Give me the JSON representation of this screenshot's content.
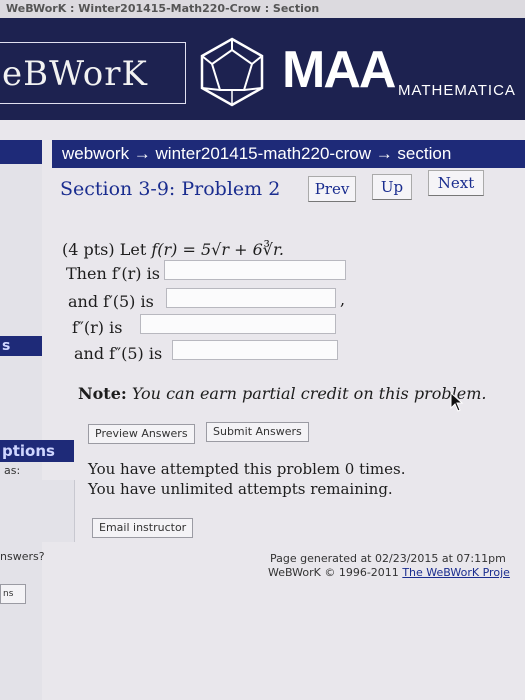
{
  "window": {
    "title": "WeBWorK : Winter201415-Math220-Crow : Section"
  },
  "banner": {
    "brand": "eBWorK",
    "maa": "MAA",
    "maa_sub": "MATHEMATICA"
  },
  "leftnav": {
    "item_1": "s",
    "item_2": "ptions",
    "item_2_sub": "as:",
    "item_3": "nswers?",
    "item_4": "ns"
  },
  "breadcrumb": {
    "text": "webwork → winter201415-math220-crow → section"
  },
  "problem_nav": {
    "title": "Section 3-9: Problem 2",
    "prev": "Prev",
    "up": "Up",
    "next": "Next"
  },
  "problem": {
    "stmt_prefix": "(4 pts) Let ",
    "stmt_expr": "f(r) = 5√r + 6∛r.",
    "q1": "Then f′(r) is",
    "q2": "and f′(5) is",
    "q2_suffix": ",",
    "q3": "f″(r) is",
    "q4": "and f″(5) is",
    "note_label": "Note:",
    "note_text": "You can earn partial credit on this problem."
  },
  "buttons": {
    "preview": "Preview Answers",
    "submit": "Submit Answers",
    "email": "Email instructor"
  },
  "attempts": {
    "line1": "You have attempted this problem 0 times.",
    "line2": "You have unlimited attempts remaining."
  },
  "footer": {
    "generated": "Page generated at 02/23/2015 at 07:11pm",
    "copyright": "WeBWorK © 1996-2011",
    "project_link": "The WeBWorK Proje"
  }
}
